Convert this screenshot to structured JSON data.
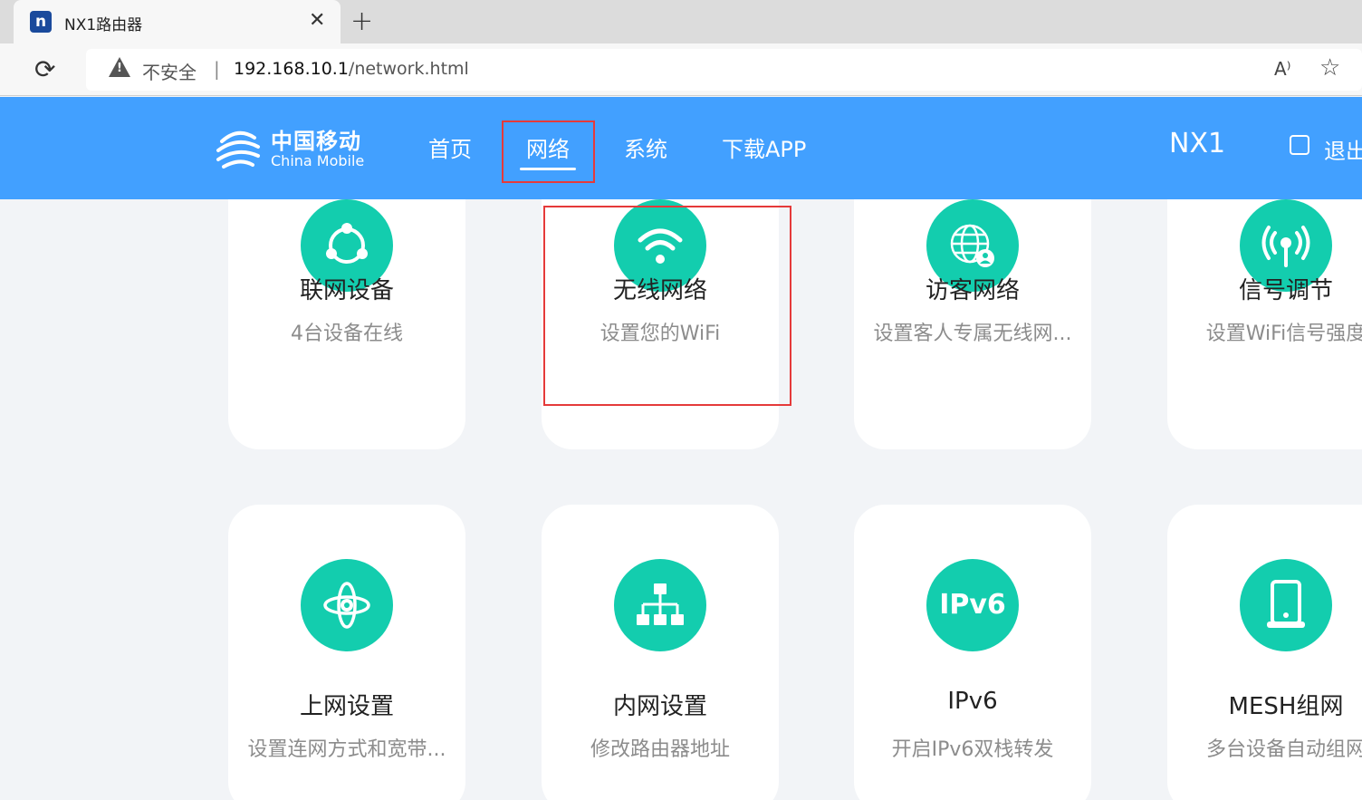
{
  "browser": {
    "tab_icon_letter": "n",
    "tab_title": "NX1路由器",
    "close_glyph": "✕",
    "new_tab_glyph": "+",
    "security_label": "不安全",
    "separator": "|",
    "url_host": "192.168.10.1",
    "url_path": "/network.html",
    "read_aloud_glyph": "A⁾",
    "favorite_glyph": "☆"
  },
  "header": {
    "logo_zh": "中国移动",
    "logo_en": "China Mobile",
    "nav": [
      {
        "label": "首页"
      },
      {
        "label": "网络"
      },
      {
        "label": "系统"
      },
      {
        "label": "下载APP"
      }
    ],
    "active_nav": "网络",
    "device_name": "NX1",
    "logout_label": "退出"
  },
  "cards": [
    {
      "title": "联网设备",
      "subtitle": "4台设备在线",
      "icon": "share-nodes-icon"
    },
    {
      "title": "无线网络",
      "subtitle": "设置您的WiFi",
      "icon": "wifi-icon"
    },
    {
      "title": "访客网络",
      "subtitle": "设置客人专属无线网...",
      "icon": "globe-user-icon"
    },
    {
      "title": "信号调节",
      "subtitle": "设置WiFi信号强度",
      "icon": "antenna-icon"
    },
    {
      "title": "上网设置",
      "subtitle": "设置连网方式和宽带...",
      "icon": "orbit-icon"
    },
    {
      "title": "内网设置",
      "subtitle": "修改路由器地址",
      "icon": "lan-tree-icon"
    },
    {
      "title": "IPv6",
      "subtitle": "开启IPv6双栈转发",
      "icon": "ipv6-icon",
      "icon_text": "IPv6"
    },
    {
      "title": "MESH组网",
      "subtitle": "多台设备自动组网",
      "icon": "mesh-device-icon"
    }
  ],
  "colors": {
    "header_bg": "#42a0ff",
    "icon_bg": "#13cdae",
    "highlight": "#e53a3a",
    "page_bg": "#f2f4f7"
  }
}
